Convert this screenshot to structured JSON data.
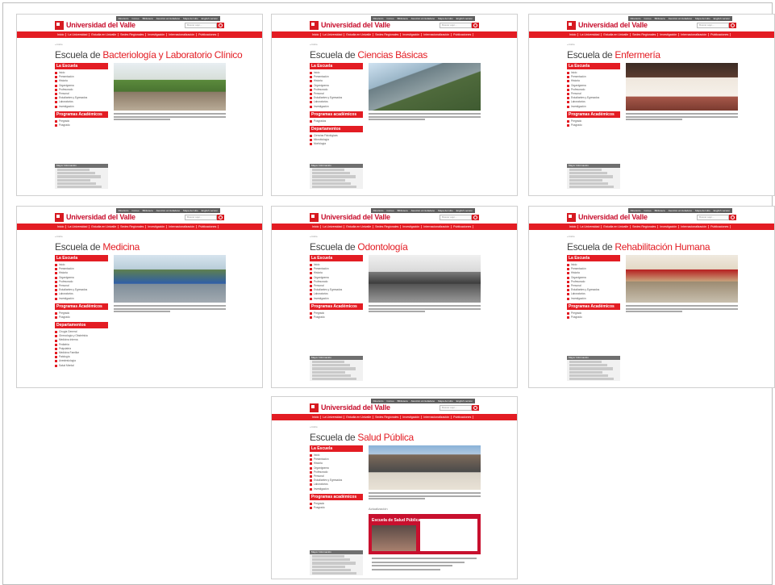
{
  "site": {
    "logo_text": "Universidad del Valle",
    "top_links": [
      "Directorio",
      "Correo",
      "Biblioteca",
      "Atención al ciudadano",
      "Mapa del sitio",
      "English version"
    ],
    "search_placeholder": "Buscar aquí...",
    "nav": [
      "Inicio",
      "La Universidad",
      "Estudia en Univalle",
      "Sedes Regionales",
      "Investigación",
      "Internacionalización",
      "Publicaciones"
    ],
    "breadcrumb": "Inicio"
  },
  "colors": {
    "brand_red": "#e31c23",
    "info_header": "#6f6f6f"
  },
  "pages": [
    {
      "title_prefix": "Escuela de ",
      "title_highlight": "Bacteriología y Laboratorio Clínico",
      "sections": [
        {
          "heading": "La Escuela",
          "items": [
            "Inicio",
            "Presentación",
            "Historia",
            "Organigrama",
            "Profesorado",
            "Personal",
            "Estudiantes y Egresados",
            "Laboratorios",
            "Investigación"
          ]
        },
        {
          "heading": "Programas Académicos",
          "items": [
            "Pregrado",
            "Posgrado"
          ]
        }
      ],
      "info_heading": "Mayor Información"
    },
    {
      "title_prefix": "Escuela de ",
      "title_highlight": "Ciencias Básicas",
      "sections": [
        {
          "heading": "La Escuela",
          "items": [
            "Inicio",
            "Presentación",
            "Historia",
            "Organigrama",
            "Profesorado",
            "Personal",
            "Estudiantes y Egresados",
            "Laboratorios",
            "Investigación"
          ]
        },
        {
          "heading": "Programas académicos",
          "items": [
            "Posgrados"
          ]
        },
        {
          "heading": "Departamentos",
          "items": [
            "Ciencias Fisiológicas",
            "Microbiología",
            "Morfología"
          ]
        }
      ],
      "info_heading": "Mayor Información"
    },
    {
      "title_prefix": "Escuela de ",
      "title_highlight": "Enfermería",
      "sections": [
        {
          "heading": "La Escuela",
          "items": [
            "Inicio",
            "Presentación",
            "Historia",
            "Organigrama",
            "Profesorado",
            "Personal",
            "Estudiantes y Egresados",
            "Laboratorios",
            "Investigación"
          ]
        },
        {
          "heading": "Programas Académicos",
          "items": [
            "Pregrado",
            "Posgrado"
          ]
        }
      ],
      "info_heading": "Mayor Información"
    },
    {
      "title_prefix": "Escuela de ",
      "title_highlight": "Medicina",
      "sections": [
        {
          "heading": "La Escuela",
          "items": [
            "Inicio",
            "Presentación",
            "Historia",
            "Organigrama",
            "Profesorado",
            "Personal",
            "Estudiantes y Egresados",
            "Laboratorios",
            "Investigación"
          ]
        },
        {
          "heading": "Programas Académicos",
          "items": [
            "Pregrado",
            "Posgrado"
          ]
        },
        {
          "heading": "Departamentos",
          "items": [
            "Cirugía General",
            "Ginecología y Obstetricia",
            "Medicina Interna",
            "Pediatría",
            "Psiquiatría",
            "Medicina Familiar",
            "Patología",
            "Anestesiología",
            "Salud Mental"
          ]
        }
      ],
      "info_heading": "Mayor Información"
    },
    {
      "title_prefix": "Escuela de ",
      "title_highlight": "Odontología",
      "sections": [
        {
          "heading": "La Escuela",
          "items": [
            "Inicio",
            "Presentación",
            "Historia",
            "Organigrama",
            "Profesorado",
            "Personal",
            "Estudiantes y Egresados",
            "Laboratorios",
            "Investigación"
          ]
        },
        {
          "heading": "Programas Académicos",
          "items": [
            "Pregrado",
            "Posgrado"
          ]
        }
      ],
      "info_heading": "Mayor Información"
    },
    {
      "title_prefix": "Escuela de ",
      "title_highlight": "Rehabilitación Humana",
      "sections": [
        {
          "heading": "La Escuela",
          "items": [
            "Inicio",
            "Presentación",
            "Historia",
            "Organigrama",
            "Profesorado",
            "Personal",
            "Estudiantes y Egresados",
            "Laboratorios",
            "Investigación"
          ]
        },
        {
          "heading": "Programas Académicos",
          "items": [
            "Pregrado",
            "Posgrado"
          ]
        }
      ],
      "info_heading": "Mayor Información"
    },
    {
      "title_prefix": "Escuela de ",
      "title_highlight": "Salud Pública",
      "sections": [
        {
          "heading": "La Escuela",
          "items": [
            "Inicio",
            "Presentación",
            "Historia",
            "Organigrama",
            "Profesorado",
            "Personal",
            "Estudiantes y Egresados",
            "Laboratorios",
            "Investigación"
          ]
        },
        {
          "heading": "Programas académicos",
          "items": [
            "Pregrado",
            "Posgrado"
          ]
        }
      ],
      "info_heading": "Mayor Información",
      "news_heading": "Actualización",
      "banner_text": "Escuela de Salud Pública"
    }
  ]
}
